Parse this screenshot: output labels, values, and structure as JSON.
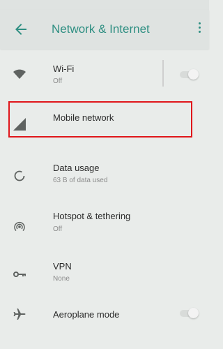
{
  "header": {
    "title": "Network & Internet",
    "back_icon": "arrow-back-icon",
    "menu_icon": "overflow-menu-icon"
  },
  "settings": {
    "wifi": {
      "label": "Wi-Fi",
      "status": "Off",
      "icon": "wifi-icon",
      "toggle_on": false
    },
    "mobile": {
      "label": "Mobile network",
      "icon": "signal-icon"
    },
    "data_usage": {
      "label": "Data usage",
      "status": "63 B of data used",
      "icon": "data-usage-icon"
    },
    "hotspot": {
      "label": "Hotspot & tethering",
      "status": "Off",
      "icon": "hotspot-icon"
    },
    "vpn": {
      "label": "VPN",
      "status": "None",
      "icon": "vpn-key-icon"
    },
    "airplane": {
      "label": "Aeroplane mode",
      "icon": "airplane-icon",
      "toggle_on": false
    }
  },
  "colors": {
    "accent": "#2f8f82",
    "highlight": "#e0161b",
    "background": "#e9ecea"
  }
}
